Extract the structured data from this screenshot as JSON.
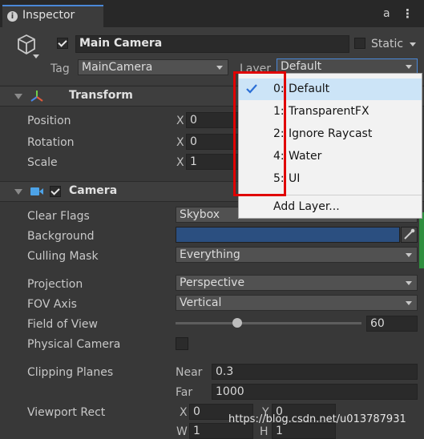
{
  "tab": {
    "title": "Inspector",
    "lock_glyph": "a",
    "menu_glyph": "⋮"
  },
  "object": {
    "enabled": true,
    "name": "Main Camera",
    "static_label": "Static",
    "static_checked": false
  },
  "tag": {
    "label": "Tag",
    "value": "MainCamera"
  },
  "layer": {
    "label": "Layer",
    "value": "Default"
  },
  "layer_menu": {
    "items": [
      {
        "number": "0:",
        "name": "Default",
        "checked": true
      },
      {
        "number": "1:",
        "name": "TransparentFX",
        "checked": false
      },
      {
        "number": "2:",
        "name": "Ignore Raycast",
        "checked": false
      },
      {
        "number": "4:",
        "name": "Water",
        "checked": false
      },
      {
        "number": "5:",
        "name": "UI",
        "checked": false
      }
    ],
    "add_label": "Add Layer..."
  },
  "transform": {
    "title": "Transform",
    "position": {
      "label": "Position",
      "axis": "X",
      "value": "0"
    },
    "rotation": {
      "label": "Rotation",
      "axis": "X",
      "value": "0"
    },
    "scale": {
      "label": "Scale",
      "axis": "X",
      "value": "1"
    }
  },
  "camera": {
    "title": "Camera",
    "enabled": true,
    "clear_flags": {
      "label": "Clear Flags",
      "value": "Skybox"
    },
    "background": {
      "label": "Background",
      "color": "#2b4f80"
    },
    "culling_mask": {
      "label": "Culling Mask",
      "value": "Everything"
    },
    "projection": {
      "label": "Projection",
      "value": "Perspective"
    },
    "fov_axis": {
      "label": "FOV Axis",
      "value": "Vertical"
    },
    "field_of_view": {
      "label": "Field of View",
      "value": "60",
      "fraction": 0.33
    },
    "physical_camera": {
      "label": "Physical Camera",
      "checked": false
    },
    "clipping_planes": {
      "label": "Clipping Planes",
      "near_label": "Near",
      "near": "0.3",
      "far_label": "Far",
      "far": "1000"
    },
    "viewport_rect": {
      "label": "Viewport Rect",
      "x_label": "X",
      "x": "0",
      "y_label": "Y",
      "y": "0",
      "w_label": "W",
      "w": "1",
      "h_label": "H",
      "h": "1"
    }
  },
  "watermark": "https://blog.csdn.net/u013787931",
  "colors": {
    "panel": "#383838",
    "accent_check": "#2b6fd6",
    "highlight": "#e00000"
  }
}
